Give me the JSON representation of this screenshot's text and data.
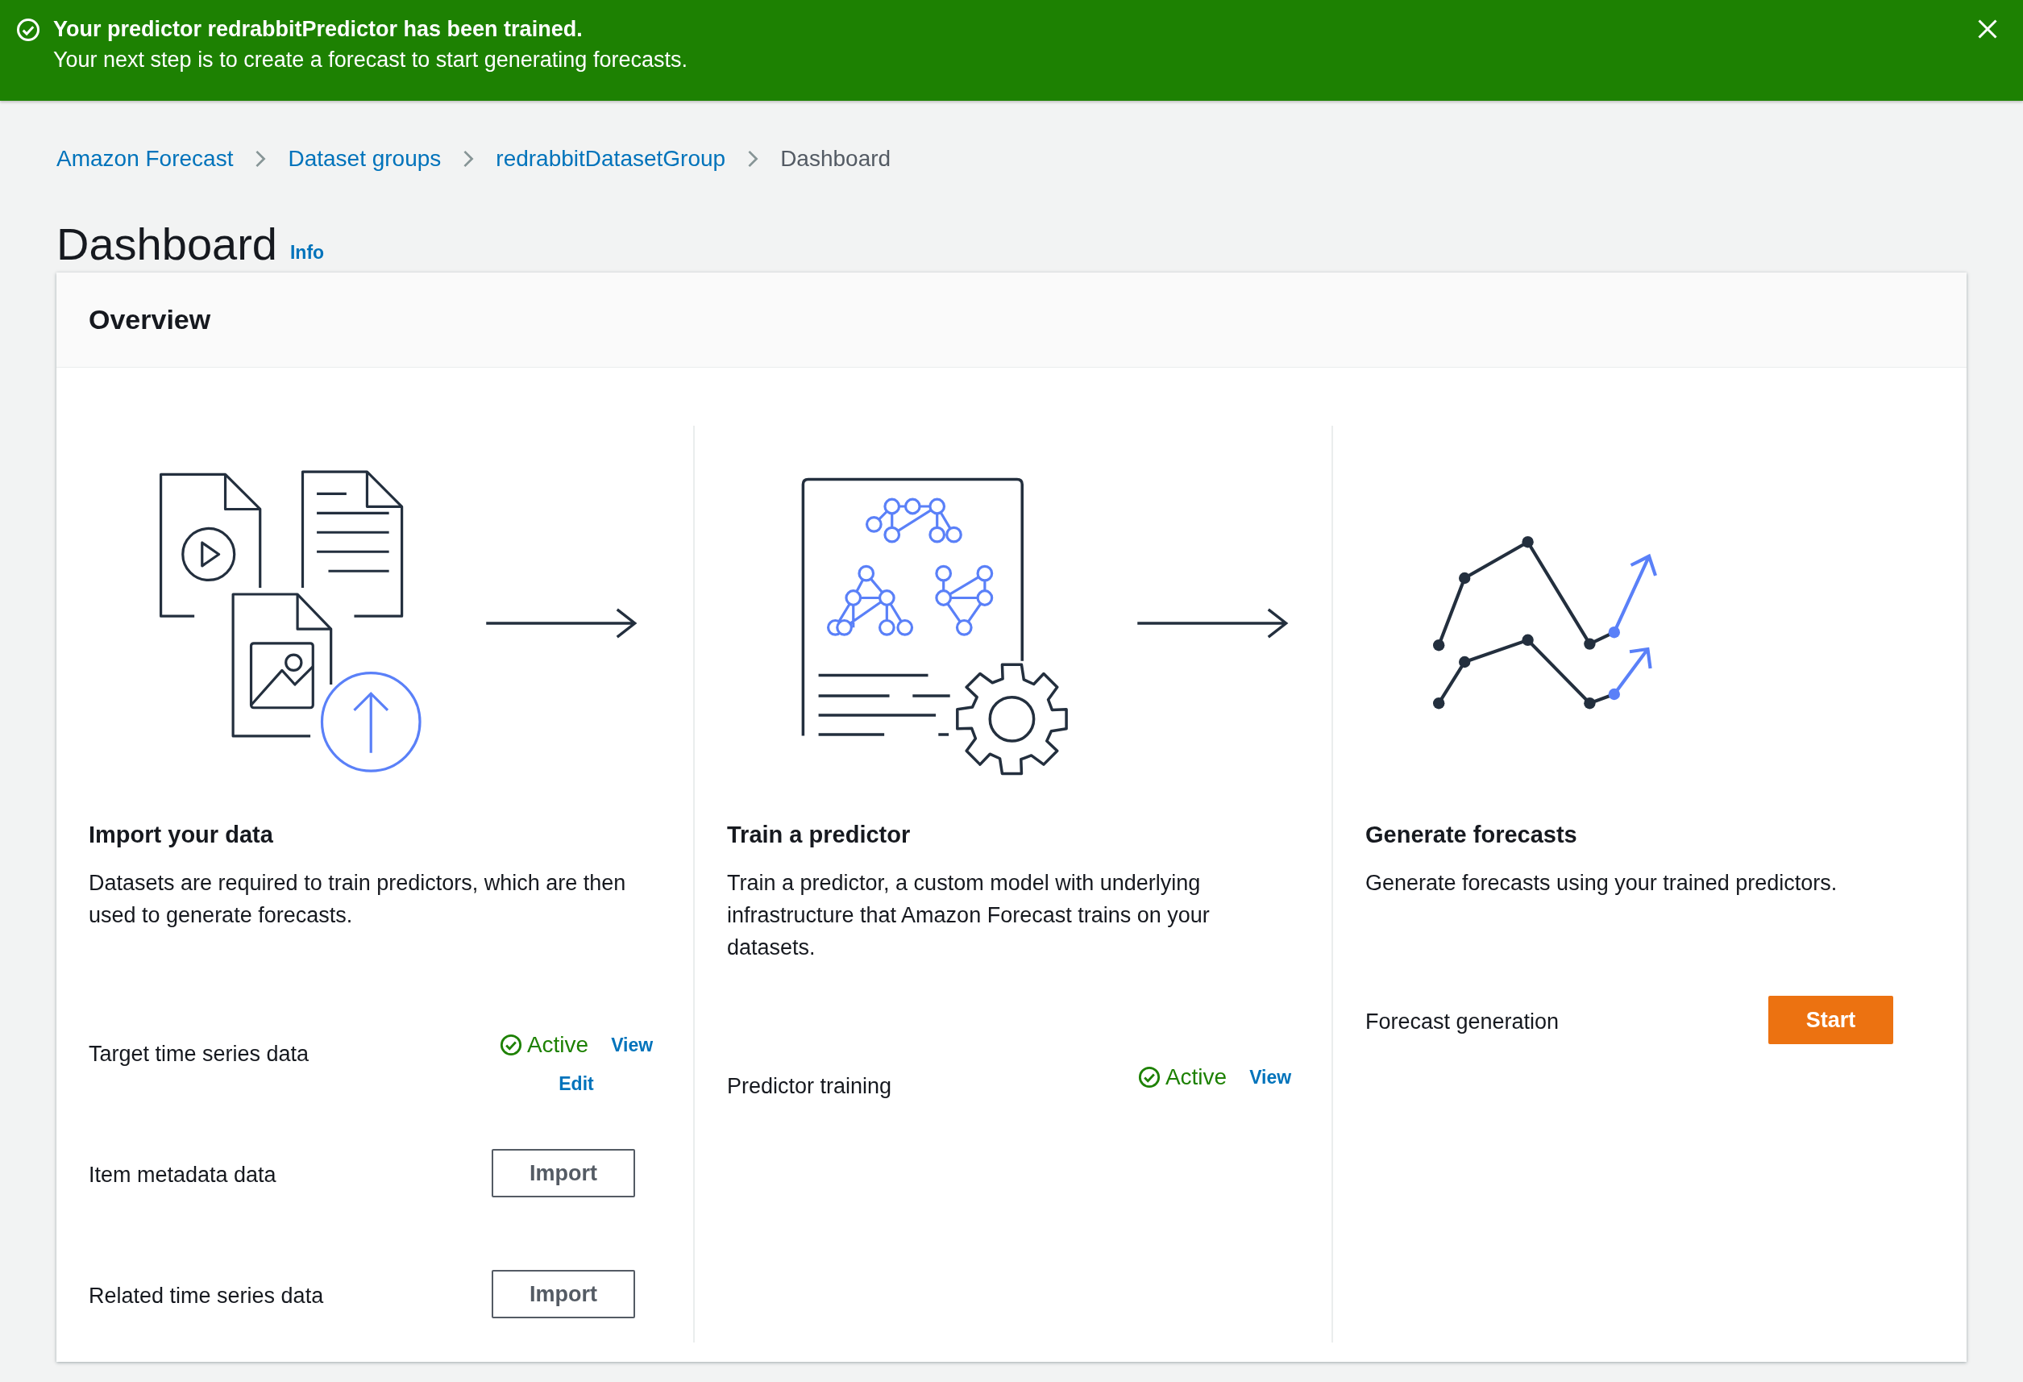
{
  "notification": {
    "kind": "success",
    "title": "Your predictor redrabbitPredictor has been trained.",
    "message": "Your next step is to create a forecast to start generating forecasts."
  },
  "breadcrumbs": [
    {
      "label": "Amazon Forecast",
      "current": false
    },
    {
      "label": "Dataset groups",
      "current": false
    },
    {
      "label": "redrabbitDatasetGroup",
      "current": false
    },
    {
      "label": "Dashboard",
      "current": true
    }
  ],
  "page": {
    "title": "Dashboard",
    "info_link": "Info"
  },
  "overview": {
    "title": "Overview",
    "steps": [
      {
        "kind": "import",
        "title": "Import your data",
        "description": "Datasets are required to train predictors, which are then used to generate forecasts.",
        "rows": [
          {
            "label": "Target time series data",
            "kind": "status",
            "status": "Active",
            "links": [
              "View",
              "Edit"
            ]
          },
          {
            "label": "Item metadata data",
            "kind": "button",
            "button": "Import"
          },
          {
            "label": "Related time series data",
            "kind": "button",
            "button": "Import"
          }
        ]
      },
      {
        "kind": "train",
        "title": "Train a predictor",
        "description": "Train a predictor, a custom model with underlying infrastructure that Amazon Forecast trains on your datasets.",
        "rows": [
          {
            "label": "Predictor training",
            "kind": "status",
            "status": "Active",
            "links": [
              "View"
            ]
          }
        ]
      },
      {
        "kind": "forecast",
        "title": "Generate forecasts",
        "description": "Generate forecasts using your trained predictors.",
        "rows": [
          {
            "label": "Forecast generation",
            "kind": "primary_button",
            "button": "Start"
          }
        ]
      }
    ]
  }
}
